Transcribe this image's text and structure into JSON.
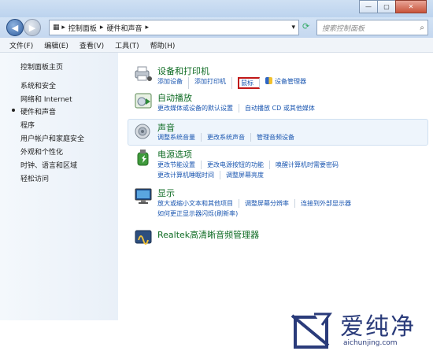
{
  "window": {
    "min": "—",
    "max": "▢",
    "close": "✕"
  },
  "nav": {
    "back": "◀",
    "forward": "▶",
    "address": [
      "控制面板",
      "硬件和声音"
    ],
    "search_placeholder": "搜索控制面板"
  },
  "menu": [
    "文件(F)",
    "编辑(E)",
    "查看(V)",
    "工具(T)",
    "帮助(H)"
  ],
  "sidebar": {
    "items": [
      "控制面板主页",
      "系统和安全",
      "网络和 Internet",
      "硬件和声音",
      "程序",
      "用户帐户和家庭安全",
      "外观和个性化",
      "时钟、语言和区域",
      "轻松访问"
    ],
    "current": "硬件和声音"
  },
  "categories": {
    "devices": {
      "title": "设备和打印机",
      "links": [
        "添加设备",
        "添加打印机",
        "鼠标",
        "设备管理器"
      ]
    },
    "autoplay": {
      "title": "自动播放",
      "links": [
        "更改媒体或设备的默认设置",
        "自动播放 CD 或其他媒体"
      ]
    },
    "sound": {
      "title": "声音",
      "links": [
        "调整系统音量",
        "更改系统声音",
        "管理音频设备"
      ]
    },
    "power": {
      "title": "电源选项",
      "links1": [
        "更改节能设置",
        "更改电源按钮的功能",
        "唤醒计算机时需要密码"
      ],
      "links2": [
        "更改计算机睡眠时间",
        "调整屏幕亮度"
      ]
    },
    "display": {
      "title": "显示",
      "links1": [
        "放大或缩小文本和其他项目",
        "调整屏幕分辨率",
        "连接到外部显示器"
      ],
      "links2": [
        "如何更正显示器闪烁(刷新率)"
      ]
    },
    "realtek": {
      "title": "Realtek高清晰音频管理器"
    }
  },
  "watermark": {
    "brand": "爱纯净",
    "url": "aichunjing.com"
  },
  "colors": {
    "title_green": "#0e6b23",
    "link_blue": "#1a56b0",
    "highlight_red": "#c01818"
  }
}
